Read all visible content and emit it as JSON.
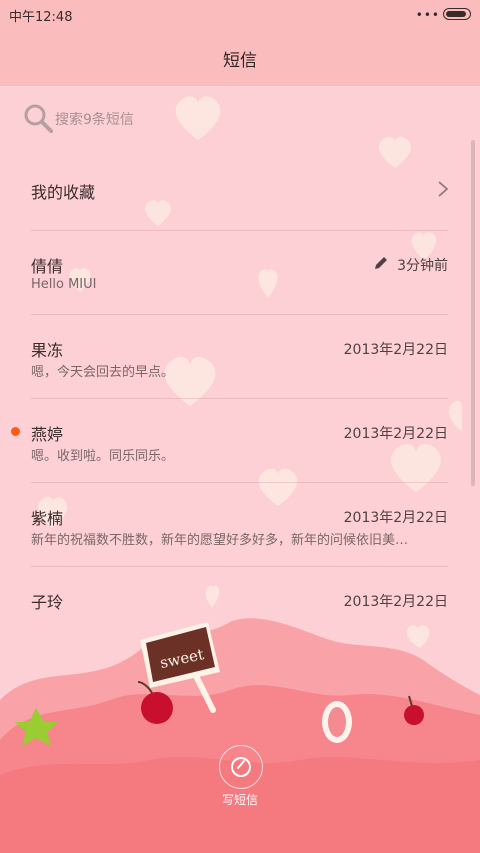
{
  "status": {
    "time": "中午12:48",
    "dots": "•••"
  },
  "header": {
    "title": "短信"
  },
  "search": {
    "placeholder": "搜索9条短信"
  },
  "favorites": {
    "label": "我的收藏"
  },
  "conversations": [
    {
      "name": "倩倩",
      "preview": "Hello MIUI",
      "time": "3分钟前",
      "draft": true,
      "unread": false
    },
    {
      "name": "果冻",
      "preview": "嗯，今天会回去的早点。",
      "time": "2013年2月22日",
      "draft": false,
      "unread": false
    },
    {
      "name": "燕婷",
      "preview": "嗯。收到啦。同乐同乐。",
      "time": "2013年2月22日",
      "draft": false,
      "unread": true
    },
    {
      "name": "紫楠",
      "preview": "新年的祝福数不胜数，新年的愿望好多好多，新年的问候依旧美…",
      "time": "2013年2月22日",
      "draft": false,
      "unread": false
    },
    {
      "name": "子玲",
      "preview": "",
      "time": "2013年2月22日",
      "draft": false,
      "unread": false
    }
  ],
  "compose": {
    "label": "写短信"
  },
  "decor": {
    "sign_text": "sweet",
    "accent": "#ff5a12"
  }
}
